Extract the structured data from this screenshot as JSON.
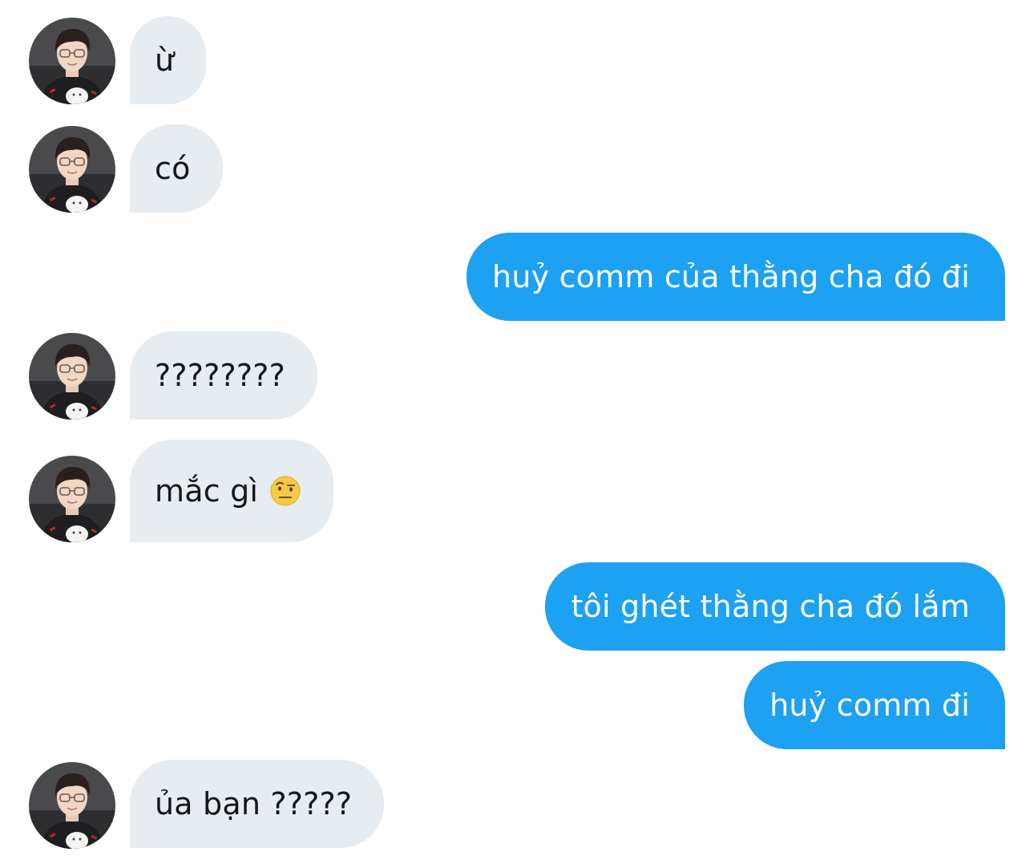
{
  "conversation": {
    "contact_avatar_icon": "profile-photo-avatar",
    "colors": {
      "incoming_bubble": "#e6ecf0",
      "incoming_text": "#14171a",
      "outgoing_bubble": "#1da1f2",
      "outgoing_text": "#ffffff"
    },
    "messages": [
      {
        "direction": "incoming",
        "text": "ừ"
      },
      {
        "direction": "incoming",
        "text": "có"
      },
      {
        "direction": "outgoing",
        "text": "huỷ comm của thằng cha đó đi"
      },
      {
        "direction": "incoming",
        "text": "????????"
      },
      {
        "direction": "incoming",
        "text": "mắc gì",
        "emoji": "face-with-raised-eyebrow-icon"
      },
      {
        "direction": "outgoing",
        "text": "tôi ghét thằng cha đó lắm"
      },
      {
        "direction": "outgoing",
        "text": "huỷ comm đi"
      },
      {
        "direction": "incoming",
        "text": "ủa bạn ?????"
      }
    ]
  }
}
